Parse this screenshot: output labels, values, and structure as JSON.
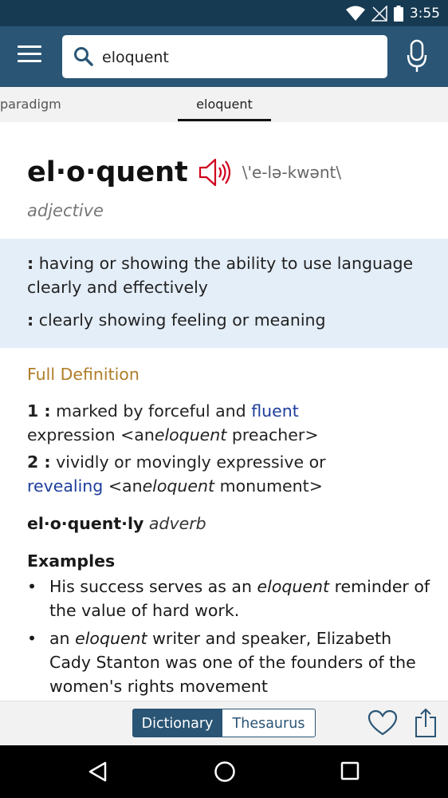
{
  "status_bar": {
    "time": "3:55"
  },
  "search": {
    "value": "eloquent"
  },
  "tabs": {
    "previous": "paradigm",
    "active": "eloquent"
  },
  "entry": {
    "headword": "el·o·quent",
    "pronunciation": "\\'e-lə-kwənt\\",
    "part_of_speech": "adjective",
    "short_definitions": [
      {
        "marker": ":",
        "text": "having or showing the ability to use language clearly and effectively"
      },
      {
        "marker": ":",
        "text": "clearly showing feeling or meaning"
      }
    ],
    "full_definition_label": "Full Definition",
    "senses": [
      {
        "num": "1 :",
        "before": "marked by forceful and",
        "link": "fluent",
        "after_plain": "expression <an",
        "italic": "eloquent",
        "after": "preacher>"
      },
      {
        "num": "2 :",
        "before": "vividly or movingly expressive or",
        "link": "revealing",
        "after_plain": "<an",
        "italic": "eloquent",
        "after": "monument>"
      }
    ],
    "run_on": {
      "word": "el·o·quent·ly",
      "pos": "adverb"
    },
    "examples_label": "Examples",
    "examples": [
      {
        "before": "His success serves as an",
        "italic": "eloquent",
        "after": "reminder of the value of hard work."
      },
      {
        "before": "an",
        "italic": "eloquent",
        "after": "writer and speaker, Elizabeth Cady Stanton was one of the founders of the women's rights movement"
      }
    ]
  },
  "bottom_bar": {
    "dictionary": "Dictionary",
    "thesaurus": "Thesaurus"
  },
  "colors": {
    "appbar": "#2a5575",
    "statusbar": "#163a52",
    "highlight": "#e4eef8",
    "link": "#1d3d9c",
    "section_label": "#b07d28",
    "speaker": "#d0021b"
  },
  "icons": [
    "menu-icon",
    "search-icon",
    "microphone-icon",
    "speaker-icon",
    "heart-icon",
    "share-icon",
    "back-icon",
    "home-icon",
    "recents-icon",
    "wifi-icon",
    "no-signal-icon",
    "battery-icon"
  ]
}
